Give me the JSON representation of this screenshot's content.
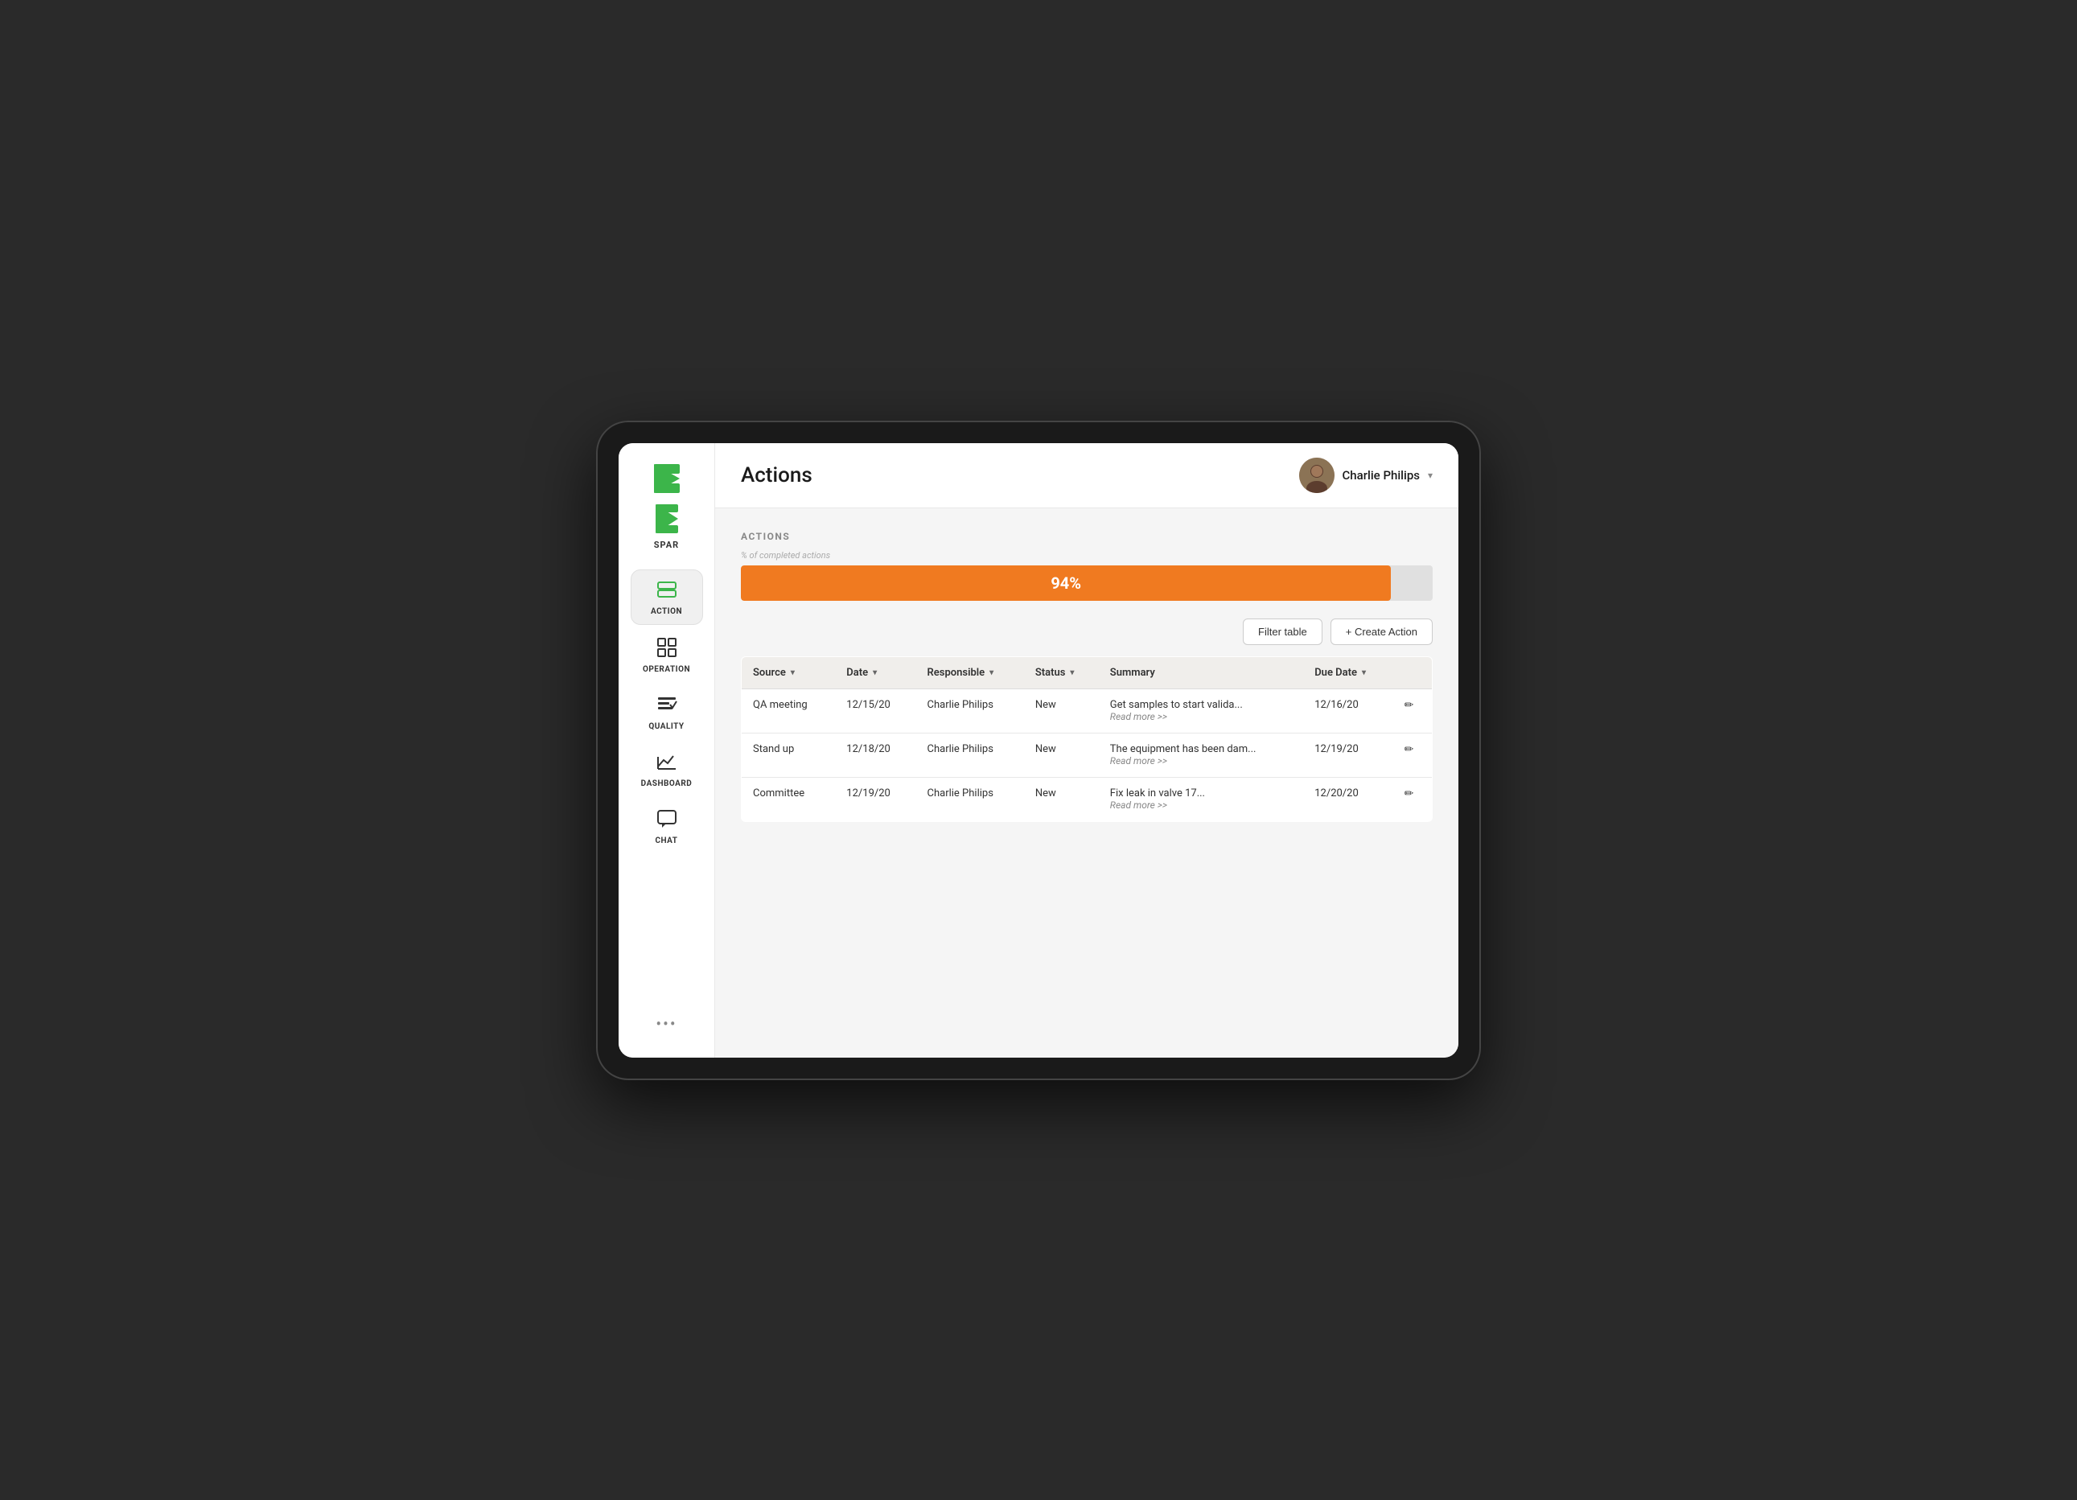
{
  "app": {
    "name": "SPAR"
  },
  "header": {
    "title": "Actions",
    "user": {
      "name": "Charlie Philips"
    }
  },
  "sidebar": {
    "items": [
      {
        "id": "action",
        "label": "ACTION",
        "active": true
      },
      {
        "id": "operation",
        "label": "OPERATION",
        "active": false
      },
      {
        "id": "quality",
        "label": "QUALITY",
        "active": false
      },
      {
        "id": "dashboard",
        "label": "DASHBOARD",
        "active": false
      },
      {
        "id": "chat",
        "label": "CHAT",
        "active": false
      }
    ],
    "more_label": "•••"
  },
  "content": {
    "section_label": "ACTIONS",
    "progress": {
      "sublabel": "% of completed actions",
      "value": 94,
      "display": "94%",
      "color": "#F07A20"
    },
    "buttons": {
      "filter": "Filter table",
      "create": "+ Create Action"
    },
    "table": {
      "columns": [
        {
          "id": "source",
          "label": "Source",
          "sortable": true
        },
        {
          "id": "date",
          "label": "Date",
          "sortable": true
        },
        {
          "id": "responsible",
          "label": "Responsible",
          "sortable": true
        },
        {
          "id": "status",
          "label": "Status",
          "sortable": true
        },
        {
          "id": "summary",
          "label": "Summary",
          "sortable": false
        },
        {
          "id": "due_date",
          "label": "Due Date",
          "sortable": true
        }
      ],
      "rows": [
        {
          "source": "QA meeting",
          "date": "12/15/20",
          "responsible": "Charlie Philips",
          "status": "New",
          "summary": "Get samples to start valida...",
          "read_more": "Read more >>",
          "due_date": "12/16/20"
        },
        {
          "source": "Stand up",
          "date": "12/18/20",
          "responsible": "Charlie Philips",
          "status": "New",
          "summary": "The equipment has been dam...",
          "read_more": "Read more >>",
          "due_date": "12/19/20"
        },
        {
          "source": "Committee",
          "date": "12/19/20",
          "responsible": "Charlie Philips",
          "status": "New",
          "summary": "Fix leak in valve 17...",
          "read_more": "Read more >>",
          "due_date": "12/20/20"
        }
      ]
    }
  }
}
